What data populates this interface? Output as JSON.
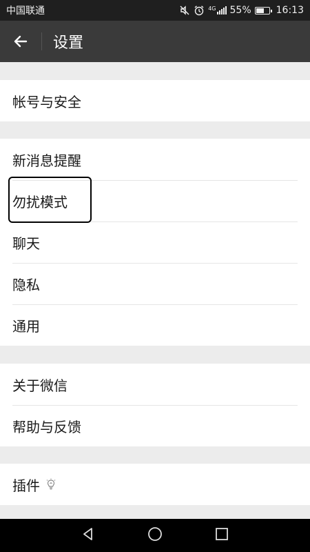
{
  "status_bar": {
    "carrier": "中国联通",
    "battery_percent": "55%",
    "battery_level": 0.55,
    "time": "16:13",
    "icons": [
      "mute-icon",
      "alarm-icon",
      "lte-signal-icon",
      "battery-icon"
    ]
  },
  "header": {
    "title": "设置",
    "back_icon": "arrow-left-icon"
  },
  "groups": [
    {
      "items": [
        {
          "label": "帐号与安全"
        }
      ]
    },
    {
      "items": [
        {
          "label": "新消息提醒"
        },
        {
          "label": "勿扰模式"
        },
        {
          "label": "聊天"
        },
        {
          "label": "隐私"
        },
        {
          "label": "通用"
        }
      ]
    },
    {
      "items": [
        {
          "label": "关于微信"
        },
        {
          "label": "帮助与反馈"
        }
      ]
    },
    {
      "items": [
        {
          "label": "插件",
          "icon": "plugin-bulb-icon"
        }
      ]
    }
  ],
  "nav_bar": {
    "icons": [
      "back-triangle-icon",
      "home-circle-icon",
      "recents-square-icon"
    ]
  },
  "colors": {
    "header_bg": "#3a3a3a",
    "status_bg": "#1f1f1f",
    "page_bg": "#ececec"
  }
}
